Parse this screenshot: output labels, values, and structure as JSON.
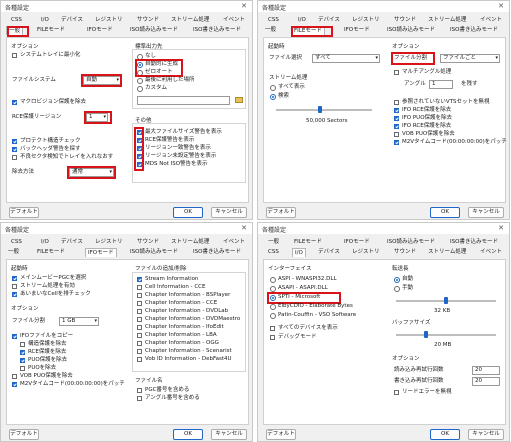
{
  "d1": {
    "title": "各種設定",
    "tabs": [
      "CSS",
      "I/O",
      "デバイス",
      "レジストリ",
      "サウンド",
      "ストリーム処理",
      "イベント",
      "一般",
      "FILEモード",
      "IFOモード",
      "ISO読み込みモード",
      "ISO書き込みモード"
    ],
    "option_header": "オプション",
    "systray": "システムトレイに最小化",
    "fs_label": "ファイルシステム",
    "fs_value": "自動",
    "macrovision": "マクロビジョン保護を除去",
    "rce_label": "RCE保護リージョン",
    "rce_value": "1",
    "protect_struct": "プロテクト構造チェック",
    "backup_warn": "バックヘッダ警告を探す",
    "parity_check": "不良セクタ検知でトレイを入れなおす",
    "remove_label": "除去方法",
    "remove_value": "通常",
    "std_output_header": "標準出力先",
    "out_none": "なし",
    "out_auto": "自動的に生成",
    "out_fixed": "ゼロオート",
    "out_last": "最後に利用した場所",
    "out_custom": "カスタム",
    "misc_header": "その他",
    "misc1": "最大ファイルサイズ警告を表示",
    "misc2": "RCE保護警告を表示",
    "misc3": "リージョン一致警告を表示",
    "misc4": "リージョン未設定警告を表示",
    "misc5": "MDS Not ISO警告を表示",
    "default_btn": "デフォルト",
    "ok_btn": "OK",
    "cancel_btn": "キャンセル"
  },
  "d2": {
    "title": "各種設定",
    "tabs": [
      "CSS",
      "I/O",
      "デバイス",
      "レジストリ",
      "サウンド",
      "ストリーム処理",
      "イベント",
      "一般",
      "FILEモード",
      "IFOモード",
      "ISO読み込みモード",
      "ISO書き込みモード"
    ],
    "startup_header": "起動時",
    "filter_label": "ファイル選択",
    "filter_value": "すべて",
    "stream_header": "ストリーム処理",
    "show_all": "すべて表示",
    "search": "検索",
    "sectors": "50,000 Sectors",
    "option_header": "オプション",
    "split_label": "ファイル分割",
    "split_value": "ファイルごと",
    "multi_angle": "マルチアングル処理",
    "angle_label": "アングル",
    "angle_value": "1",
    "angle_btn": "を残す",
    "o1": "参照されていないVTSセットを無視",
    "o2": "IFO RCE保護を除去",
    "o3": "IFO PUO保護を除去",
    "o4": "IFO RCE保護を除去",
    "o5": "VOB PUO保護を除去",
    "o6": "M2Vタイムコード(00:00:00:00)をパッチ",
    "default_btn": "デフォルト",
    "ok_btn": "OK",
    "cancel_btn": "キャンセル"
  },
  "d3": {
    "title": "各種設定",
    "tabs": [
      "CSS",
      "I/O",
      "デバイス",
      "レジストリ",
      "サウンド",
      "ストリーム処理",
      "イベント",
      "一般",
      "FILEモード",
      "IFOモード",
      "ISO読み込みモード",
      "ISO書き込みモード"
    ],
    "startup_header": "起動時",
    "s1": "メインムービーPGCを選択",
    "s2": "ストリーム処理を有効",
    "s3": "あいまいなCellを排チェック",
    "option_header": "オプション",
    "split_label": "ファイル分割",
    "split_value": "1 GB",
    "ifo_copy": "IFOファイルをコピー",
    "c1": "構造保護を除去",
    "c2": "RCE保護を除去",
    "c3": "PUO保護を除去",
    "c4": "PUOを除去",
    "vob_puo": "VOB PUO保護を除去",
    "m2v": "M2Vタイムコード(00:00:00:00)をパッチ",
    "info_header": "ファイルの追加/削除",
    "info": [
      "Stream Information",
      "Cell Information - CCE",
      "Chapter Information - BSPlayer",
      "Chapter Information - CCE",
      "Chapter Information - DVDLab",
      "Chapter Information - DVDMaestro",
      "Chapter Information - IfoEdit",
      "Chapter Information - LBA",
      "Chapter Information - OGG",
      "Chapter Information - Scenarist",
      "Vob ID Information - DebFast4U"
    ],
    "filename_header": "ファイル名",
    "f1": "PGC番号を含める",
    "f2": "アングル番号を含める",
    "default_btn": "デフォルト",
    "ok_btn": "OK",
    "cancel_btn": "キャンセル"
  },
  "d4": {
    "title": "各種設定",
    "tabs": [
      "一般",
      "FILEモード",
      "IFOモード",
      "ISO読み込みモード",
      "ISO書き込みモード",
      "CSS",
      "I/O",
      "デバイス",
      "レジストリ",
      "サウンド",
      "ストリーム処理",
      "イベント"
    ],
    "iface_header": "インターフェイス",
    "i1": "ASPI - WNASPI32.DLL",
    "i2": "ASAPI - ASAPI.DLL",
    "i3": "SPTI - Microsoft",
    "i4": "ElbyCDIO - Elaborate Bytes",
    "i5": "Patin-Couffin - VSO Software",
    "showall": "すべてのデバイスを表示",
    "debug": "デバッグモード",
    "speed_header": "転送長",
    "sp_auto": "自動",
    "sp_manual": "手動",
    "sp_value": "32 KB",
    "buffer_header": "バッファサイズ",
    "buffer_value": "20 MB",
    "opt_header": "オプション",
    "read_retry": "読み込み再試行回数",
    "read_val": "20",
    "write_retry": "書き込み再試行回数",
    "write_val": "20",
    "lead_error": "リードエラーを無視",
    "default_btn": "デフォルト",
    "ok_btn": "OK",
    "cancel_btn": "キャンセル"
  }
}
